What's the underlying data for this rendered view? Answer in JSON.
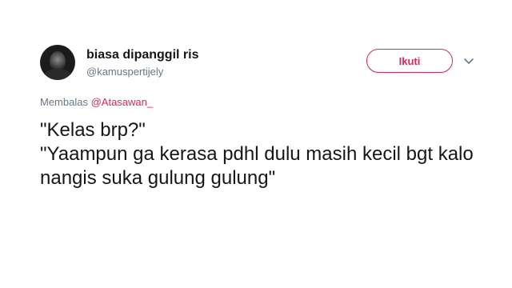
{
  "author": {
    "display_name": "biasa dipanggil ris",
    "handle": "@kamuspertijely"
  },
  "actions": {
    "follow_label": "Ikuti",
    "menu_icon": "chevron-down-icon"
  },
  "reply": {
    "prefix": "Membalas",
    "mention": "@Atasawan_"
  },
  "tweet": {
    "lines": [
      "\"Kelas brp?\"",
      "\"Yaampun ga kerasa pdhl dulu masih kecil bgt kalo nangis suka gulung gulung\""
    ]
  },
  "colors": {
    "accent": "#e0245e",
    "secondary_text": "#657786",
    "primary_text": "#14171a"
  }
}
